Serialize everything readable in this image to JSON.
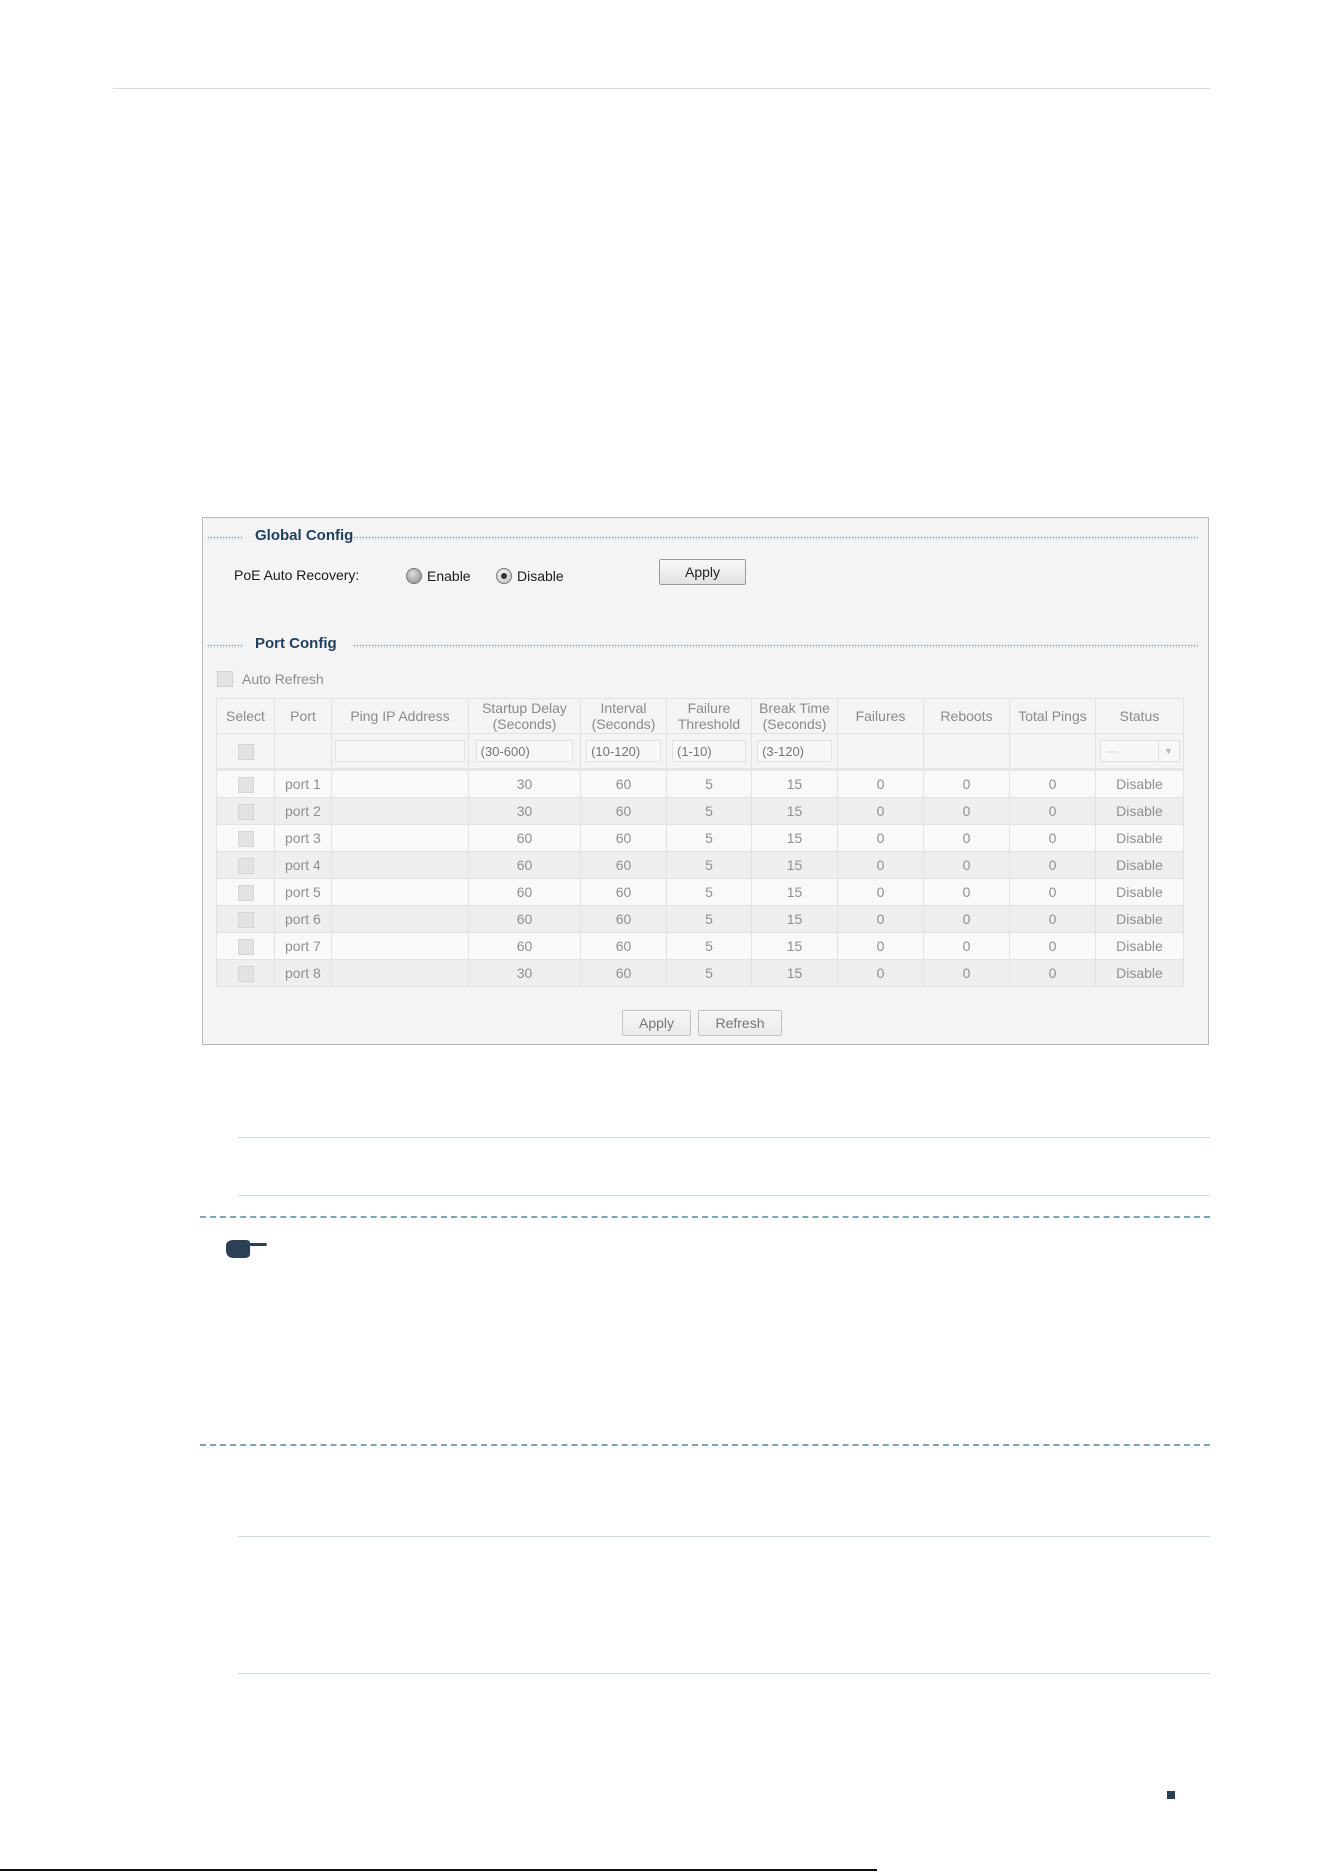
{
  "global_config": {
    "title": "Global Config",
    "poe_label": "PoE Auto Recovery:",
    "enable_label": "Enable",
    "disable_label": "Disable",
    "selected": "Disable",
    "apply_label": "Apply"
  },
  "port_config": {
    "title": "Port Config",
    "auto_refresh_label": "Auto Refresh",
    "columns": {
      "select": "Select",
      "port": "Port",
      "ping_ip": "Ping IP Address",
      "startup_delay_1": "Startup Delay",
      "startup_delay_2": "(Seconds)",
      "interval_1": "Interval",
      "interval_2": "(Seconds)",
      "failure_1": "Failure",
      "failure_2": "Threshold",
      "break_1": "Break Time",
      "break_2": "(Seconds)",
      "failures": "Failures",
      "reboots": "Reboots",
      "total_pings": "Total Pings",
      "status": "Status"
    },
    "placeholders": {
      "startup_delay": "(30-600)",
      "interval": "(10-120)",
      "failure_threshold": "(1-10)",
      "break_time": "(3-120)",
      "status_select": "---"
    },
    "rows": [
      {
        "port": "port 1",
        "startup_delay": "30",
        "interval": "60",
        "failure_threshold": "5",
        "break_time": "15",
        "failures": "0",
        "reboots": "0",
        "total_pings": "0",
        "status": "Disable"
      },
      {
        "port": "port 2",
        "startup_delay": "30",
        "interval": "60",
        "failure_threshold": "5",
        "break_time": "15",
        "failures": "0",
        "reboots": "0",
        "total_pings": "0",
        "status": "Disable"
      },
      {
        "port": "port 3",
        "startup_delay": "60",
        "interval": "60",
        "failure_threshold": "5",
        "break_time": "15",
        "failures": "0",
        "reboots": "0",
        "total_pings": "0",
        "status": "Disable"
      },
      {
        "port": "port 4",
        "startup_delay": "60",
        "interval": "60",
        "failure_threshold": "5",
        "break_time": "15",
        "failures": "0",
        "reboots": "0",
        "total_pings": "0",
        "status": "Disable"
      },
      {
        "port": "port 5",
        "startup_delay": "60",
        "interval": "60",
        "failure_threshold": "5",
        "break_time": "15",
        "failures": "0",
        "reboots": "0",
        "total_pings": "0",
        "status": "Disable"
      },
      {
        "port": "port 6",
        "startup_delay": "60",
        "interval": "60",
        "failure_threshold": "5",
        "break_time": "15",
        "failures": "0",
        "reboots": "0",
        "total_pings": "0",
        "status": "Disable"
      },
      {
        "port": "port 7",
        "startup_delay": "60",
        "interval": "60",
        "failure_threshold": "5",
        "break_time": "15",
        "failures": "0",
        "reboots": "0",
        "total_pings": "0",
        "status": "Disable"
      },
      {
        "port": "port 8",
        "startup_delay": "30",
        "interval": "60",
        "failure_threshold": "5",
        "break_time": "15",
        "failures": "0",
        "reboots": "0",
        "total_pings": "0",
        "status": "Disable"
      }
    ],
    "apply_label": "Apply",
    "refresh_label": "Refresh"
  },
  "icons": {
    "note": "pointing-hand-icon",
    "page_marker": "square-marker-icon"
  },
  "colors": {
    "section_title": "#1f3f5f",
    "rule": "#cfdbe0",
    "dash": "#7fa3b3",
    "marker": "#2b3f55"
  }
}
